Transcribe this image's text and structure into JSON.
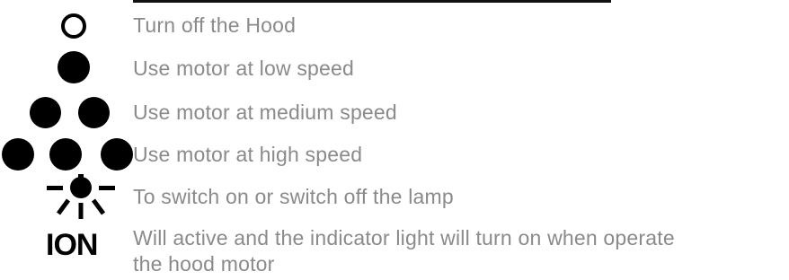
{
  "legend": {
    "items": [
      {
        "icon": "ring-icon",
        "text": "Turn off the Hood"
      },
      {
        "icon": "one-dot-icon",
        "text": "Use motor at low speed"
      },
      {
        "icon": "two-dots-icon",
        "text": "Use motor at medium speed"
      },
      {
        "icon": "three-dots-icon",
        "text": "Use motor at high speed"
      },
      {
        "icon": "lamp-icon",
        "text": "To switch on or switch off the lamp"
      },
      {
        "icon": "ion-icon",
        "icon_text": "ION",
        "text_line1": "Will active and the indicator light will turn on when operate",
        "text_line2": "the hood motor"
      }
    ]
  }
}
